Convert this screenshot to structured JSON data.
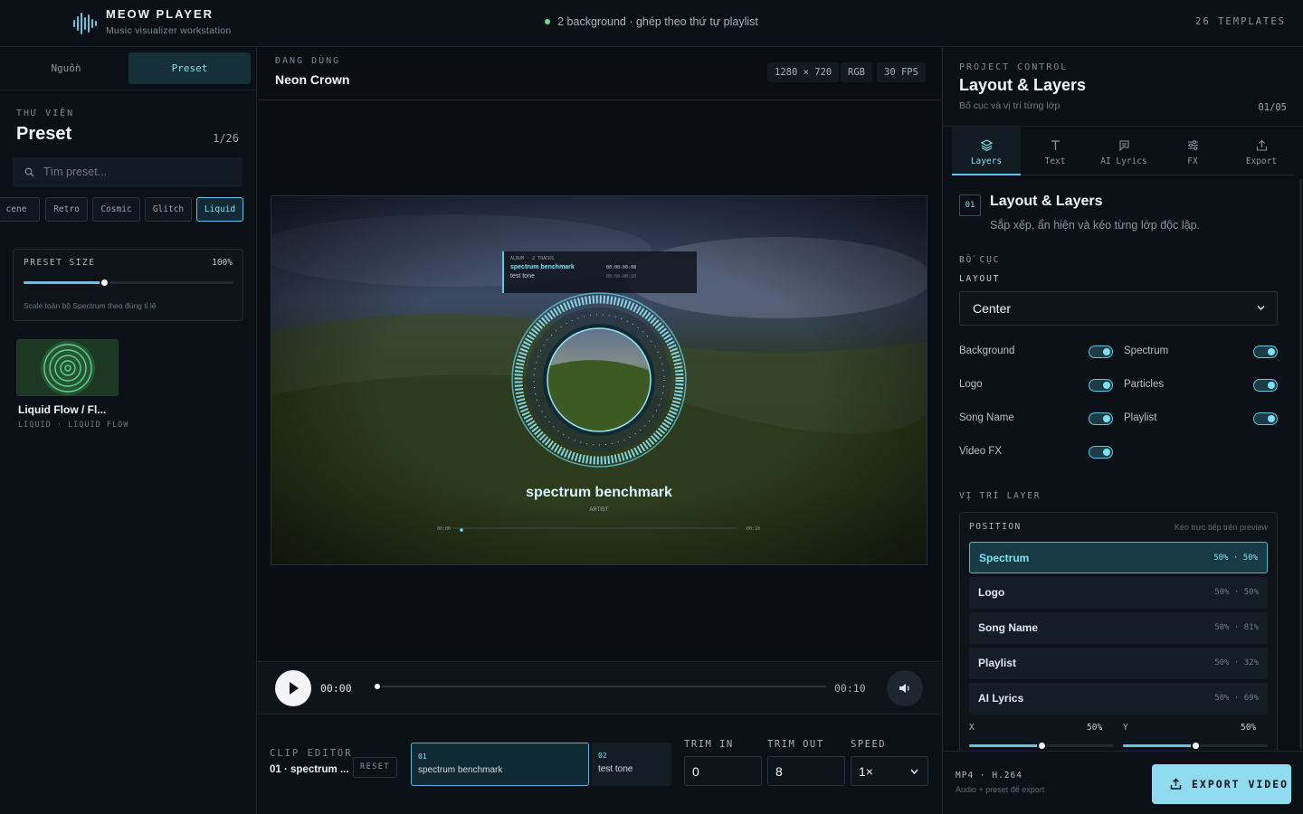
{
  "header": {
    "app_name": "MEOW PLAYER",
    "tagline": "Music visualizer workstation",
    "status": "2 background · ghép theo thứ tự playlist",
    "templates": "26 TEMPLATES"
  },
  "left": {
    "tabs": [
      {
        "label": "Nguồn"
      },
      {
        "label": "Preset"
      }
    ],
    "library_kicker": "THƯ VIỆN",
    "library_title": "Preset",
    "library_count": "1/26",
    "search_placeholder": "Tìm preset...",
    "chips": [
      {
        "label": "cene"
      },
      {
        "label": "Retro"
      },
      {
        "label": "Cosmic"
      },
      {
        "label": "Glitch"
      },
      {
        "label": "Liquid",
        "active": true
      }
    ],
    "preset_size": {
      "label": "PRESET SIZE",
      "value": "100%",
      "level": 1.0,
      "hint": "Scale toàn bộ Spectrum theo đúng tỉ lệ"
    },
    "preset_card": {
      "title": "Liquid Flow / Fl...",
      "subtitle": "LIQUID · LIQUID FLOW"
    }
  },
  "center": {
    "kicker": "ĐANG DÙNG",
    "preset_name": "Neon Crown",
    "badges": [
      "1280 × 720",
      "RGB",
      "30 FPS"
    ],
    "preview": {
      "album": "ALBUM · 2 TRACKS",
      "track1": "spectrum benchmark",
      "track2": "test tone",
      "time1": "00:00-00:08",
      "time2": "00:08-00:10",
      "song_title": "spectrum benchmark",
      "artist": "ARTIST",
      "mini_start": "00:00",
      "mini_end": "00:10"
    },
    "transport": {
      "current": "00:00",
      "end": "00:10",
      "progress": 0.0
    },
    "clip_editor": {
      "kicker": "CLIP EDITOR",
      "current": "01 · spectrum ...",
      "reset": "RESET",
      "segments": [
        {
          "index": "01",
          "title": "spectrum benchmark",
          "active": true
        },
        {
          "index": "02",
          "title": "test tone"
        }
      ],
      "trim_in_label": "TRIM IN",
      "trim_in": "0",
      "trim_out_label": "TRIM OUT",
      "trim_out": "8",
      "speed_label": "SPEED",
      "speed": "1×"
    }
  },
  "right": {
    "kicker": "PROJECT CONTROL",
    "title": "Layout & Layers",
    "subtitle": "Bố cục và vị trí từng lớp",
    "step": "01/05",
    "tabs": [
      {
        "label": "Layers",
        "icon": "layers-icon",
        "active": true
      },
      {
        "label": "Text",
        "icon": "text-icon"
      },
      {
        "label": "AI Lyrics",
        "icon": "chat-icon"
      },
      {
        "label": "FX",
        "icon": "sliders-icon"
      },
      {
        "label": "Export",
        "icon": "upload-icon"
      }
    ],
    "section": {
      "number": "01",
      "title": "Layout & Layers",
      "desc": "Sắp xếp, ẩn hiện và kéo từng lớp độc lập."
    },
    "layout_group": "BỐ CỤC",
    "layout_label": "LAYOUT",
    "layout_value": "Center",
    "toggles": [
      {
        "label": "Background",
        "on": true
      },
      {
        "label": "Spectrum",
        "on": true
      },
      {
        "label": "Logo",
        "on": true
      },
      {
        "label": "Particles",
        "on": true
      },
      {
        "label": "Song Name",
        "on": true
      },
      {
        "label": "Playlist",
        "on": true
      },
      {
        "label": "Video FX",
        "on": true
      }
    ],
    "position_group": "VỊ TRÍ LAYER",
    "position": {
      "label": "POSITION",
      "hint": "Kéo trực tiếp trên preview",
      "rows": [
        {
          "name": "Spectrum",
          "value": "50% · 50%",
          "active": true
        },
        {
          "name": "Logo",
          "value": "50% · 50%"
        },
        {
          "name": "Song Name",
          "value": "50% · 81%"
        },
        {
          "name": "Playlist",
          "value": "50% · 32%"
        },
        {
          "name": "AI Lyrics",
          "value": "50% · 69%"
        }
      ],
      "x_label": "X",
      "x_value": "50%",
      "y_label": "Y",
      "y_value": "50%"
    },
    "footer": {
      "format": "MP4 · H.264",
      "note": "Audio + preset để export",
      "export": "EXPORT VIDEO"
    }
  },
  "colors": {
    "accent": "#5ac8e0",
    "background": "#0c1117",
    "export_button": "#8fdcf0"
  }
}
